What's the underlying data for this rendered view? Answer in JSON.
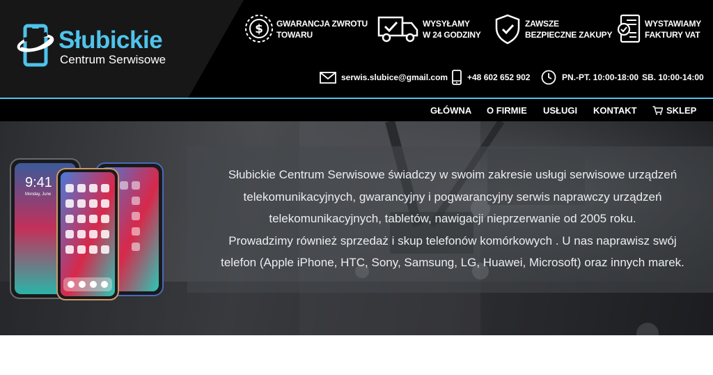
{
  "brand": {
    "title": "Słubickie",
    "subtitle": "Centrum Serwisowe",
    "accent_color": "#4fc3ec"
  },
  "features": [
    {
      "icon": "dollar-circle-icon",
      "line1": "GWARANCJA ZWROTU",
      "line2": "TOWARU"
    },
    {
      "icon": "delivery-truck-icon",
      "line1": "WYSYŁAMY",
      "line2": "W 24 GODZINY"
    },
    {
      "icon": "shield-check-icon",
      "line1": "ZAWSZE",
      "line2": "BEZPIECZNE ZAKUPY"
    },
    {
      "icon": "invoice-icon",
      "line1": "WYSTAWIAMY",
      "line2": "FAKTURY VAT"
    }
  ],
  "contact": {
    "email": "serwis.slubice@gmail.com",
    "phone": "+48 602 652 902",
    "hours_weekday": "PN.-PT. 10:00-18:00",
    "hours_saturday": "SB. 10:00-14:00"
  },
  "nav": {
    "items": [
      "GŁÓWNA",
      "O FIRMIE",
      "USŁUGI",
      "KONTAKT",
      "SKLEP"
    ]
  },
  "hero": {
    "lines": [
      "Słubickie Centrum Serwisowe świadczy w swoim zakresie usługi serwisowe urządzeń",
      "telekomunikacyjnych, gwarancyjny i pogwarancyjny serwis naprawczy urządzeń",
      "telekomunikacyjnych, tabletów, nawigacji nieprzerwanie od 2005 roku.",
      "Prowadzimy również sprzedaż i skup telefonów komórkowych . U nas naprawisz swój",
      "telefon (Apple iPhone, HTC, Sony, Samsung, LG, Huawei, Microsoft) oraz innych marek."
    ],
    "phone_time": "9:41",
    "phone_date": "Monday, June"
  }
}
